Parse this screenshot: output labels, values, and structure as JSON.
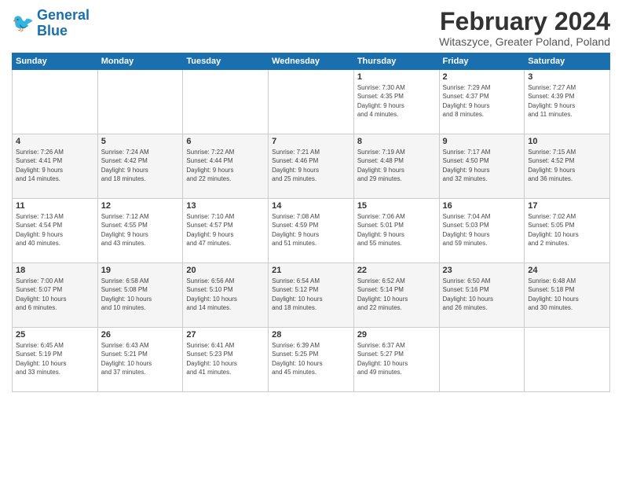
{
  "logo": {
    "line1": "General",
    "line2": "Blue"
  },
  "title": "February 2024",
  "subtitle": "Witaszyce, Greater Poland, Poland",
  "days_header": [
    "Sunday",
    "Monday",
    "Tuesday",
    "Wednesday",
    "Thursday",
    "Friday",
    "Saturday"
  ],
  "weeks": [
    [
      {
        "day": "",
        "info": ""
      },
      {
        "day": "",
        "info": ""
      },
      {
        "day": "",
        "info": ""
      },
      {
        "day": "",
        "info": ""
      },
      {
        "day": "1",
        "info": "Sunrise: 7:30 AM\nSunset: 4:35 PM\nDaylight: 9 hours\nand 4 minutes."
      },
      {
        "day": "2",
        "info": "Sunrise: 7:29 AM\nSunset: 4:37 PM\nDaylight: 9 hours\nand 8 minutes."
      },
      {
        "day": "3",
        "info": "Sunrise: 7:27 AM\nSunset: 4:39 PM\nDaylight: 9 hours\nand 11 minutes."
      }
    ],
    [
      {
        "day": "4",
        "info": "Sunrise: 7:26 AM\nSunset: 4:41 PM\nDaylight: 9 hours\nand 14 minutes."
      },
      {
        "day": "5",
        "info": "Sunrise: 7:24 AM\nSunset: 4:42 PM\nDaylight: 9 hours\nand 18 minutes."
      },
      {
        "day": "6",
        "info": "Sunrise: 7:22 AM\nSunset: 4:44 PM\nDaylight: 9 hours\nand 22 minutes."
      },
      {
        "day": "7",
        "info": "Sunrise: 7:21 AM\nSunset: 4:46 PM\nDaylight: 9 hours\nand 25 minutes."
      },
      {
        "day": "8",
        "info": "Sunrise: 7:19 AM\nSunset: 4:48 PM\nDaylight: 9 hours\nand 29 minutes."
      },
      {
        "day": "9",
        "info": "Sunrise: 7:17 AM\nSunset: 4:50 PM\nDaylight: 9 hours\nand 32 minutes."
      },
      {
        "day": "10",
        "info": "Sunrise: 7:15 AM\nSunset: 4:52 PM\nDaylight: 9 hours\nand 36 minutes."
      }
    ],
    [
      {
        "day": "11",
        "info": "Sunrise: 7:13 AM\nSunset: 4:54 PM\nDaylight: 9 hours\nand 40 minutes."
      },
      {
        "day": "12",
        "info": "Sunrise: 7:12 AM\nSunset: 4:55 PM\nDaylight: 9 hours\nand 43 minutes."
      },
      {
        "day": "13",
        "info": "Sunrise: 7:10 AM\nSunset: 4:57 PM\nDaylight: 9 hours\nand 47 minutes."
      },
      {
        "day": "14",
        "info": "Sunrise: 7:08 AM\nSunset: 4:59 PM\nDaylight: 9 hours\nand 51 minutes."
      },
      {
        "day": "15",
        "info": "Sunrise: 7:06 AM\nSunset: 5:01 PM\nDaylight: 9 hours\nand 55 minutes."
      },
      {
        "day": "16",
        "info": "Sunrise: 7:04 AM\nSunset: 5:03 PM\nDaylight: 9 hours\nand 59 minutes."
      },
      {
        "day": "17",
        "info": "Sunrise: 7:02 AM\nSunset: 5:05 PM\nDaylight: 10 hours\nand 2 minutes."
      }
    ],
    [
      {
        "day": "18",
        "info": "Sunrise: 7:00 AM\nSunset: 5:07 PM\nDaylight: 10 hours\nand 6 minutes."
      },
      {
        "day": "19",
        "info": "Sunrise: 6:58 AM\nSunset: 5:08 PM\nDaylight: 10 hours\nand 10 minutes."
      },
      {
        "day": "20",
        "info": "Sunrise: 6:56 AM\nSunset: 5:10 PM\nDaylight: 10 hours\nand 14 minutes."
      },
      {
        "day": "21",
        "info": "Sunrise: 6:54 AM\nSunset: 5:12 PM\nDaylight: 10 hours\nand 18 minutes."
      },
      {
        "day": "22",
        "info": "Sunrise: 6:52 AM\nSunset: 5:14 PM\nDaylight: 10 hours\nand 22 minutes."
      },
      {
        "day": "23",
        "info": "Sunrise: 6:50 AM\nSunset: 5:16 PM\nDaylight: 10 hours\nand 26 minutes."
      },
      {
        "day": "24",
        "info": "Sunrise: 6:48 AM\nSunset: 5:18 PM\nDaylight: 10 hours\nand 30 minutes."
      }
    ],
    [
      {
        "day": "25",
        "info": "Sunrise: 6:45 AM\nSunset: 5:19 PM\nDaylight: 10 hours\nand 33 minutes."
      },
      {
        "day": "26",
        "info": "Sunrise: 6:43 AM\nSunset: 5:21 PM\nDaylight: 10 hours\nand 37 minutes."
      },
      {
        "day": "27",
        "info": "Sunrise: 6:41 AM\nSunset: 5:23 PM\nDaylight: 10 hours\nand 41 minutes."
      },
      {
        "day": "28",
        "info": "Sunrise: 6:39 AM\nSunset: 5:25 PM\nDaylight: 10 hours\nand 45 minutes."
      },
      {
        "day": "29",
        "info": "Sunrise: 6:37 AM\nSunset: 5:27 PM\nDaylight: 10 hours\nand 49 minutes."
      },
      {
        "day": "",
        "info": ""
      },
      {
        "day": "",
        "info": ""
      }
    ]
  ]
}
